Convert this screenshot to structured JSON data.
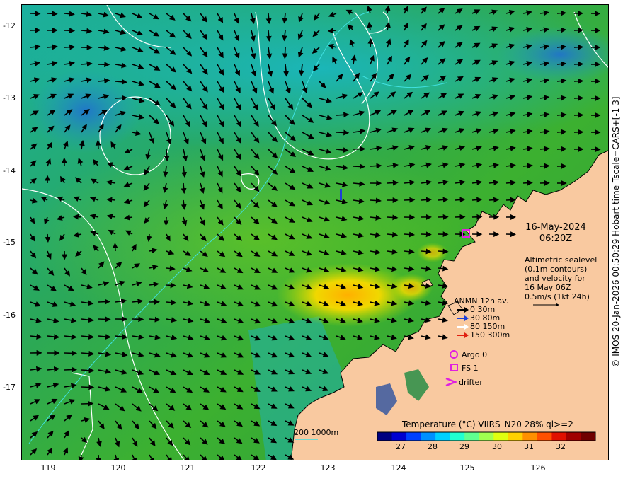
{
  "map": {
    "y_ticks": [
      "-12",
      "-13",
      "-14",
      "-15",
      "-16",
      "-17"
    ],
    "x_ticks": [
      "119",
      "120",
      "121",
      "122",
      "123",
      "124",
      "125",
      "126"
    ]
  },
  "credit": "© IMOS 20-Jan-2026 00:50:29 Hobart time Tscale=CARS+[-1 3]",
  "timestamp": {
    "date": "16-May-2024",
    "time": "06:20Z"
  },
  "altimetry_note": [
    "Altimetric sealevel",
    "(0.1m contours)",
    "and velocity for",
    "16 May 06Z",
    "0.5m/s (1kt 24h)"
  ],
  "anmn_legend": {
    "title": "ANMN 12h av.",
    "rows": [
      {
        "label": "0 30m",
        "color": "#000000"
      },
      {
        "label": "30 80m",
        "color": "#1f3fd8"
      },
      {
        "label": "80 150m",
        "color": "#ffffff"
      },
      {
        "label": "150 300m",
        "color": "#e02010"
      }
    ]
  },
  "platform_legend": [
    {
      "label": "Argo 0",
      "symbol": "circle-icon"
    },
    {
      "label": "FS 1",
      "symbol": "square-icon"
    },
    {
      "label": "drifter",
      "symbol": "chevron-icon"
    }
  ],
  "colorbar": {
    "title": "Temperature (°C) VIIRS_N20 28% ql>=2",
    "ticks": [
      "27",
      "28",
      "29",
      "30",
      "31",
      "32"
    ]
  },
  "scale_label": "200  1000m",
  "colors": {
    "land": "#f9c9a0",
    "accent_magenta": "#e020e0",
    "contour_white": "#ffffff",
    "isobath_cyan": "#40e0e0"
  }
}
